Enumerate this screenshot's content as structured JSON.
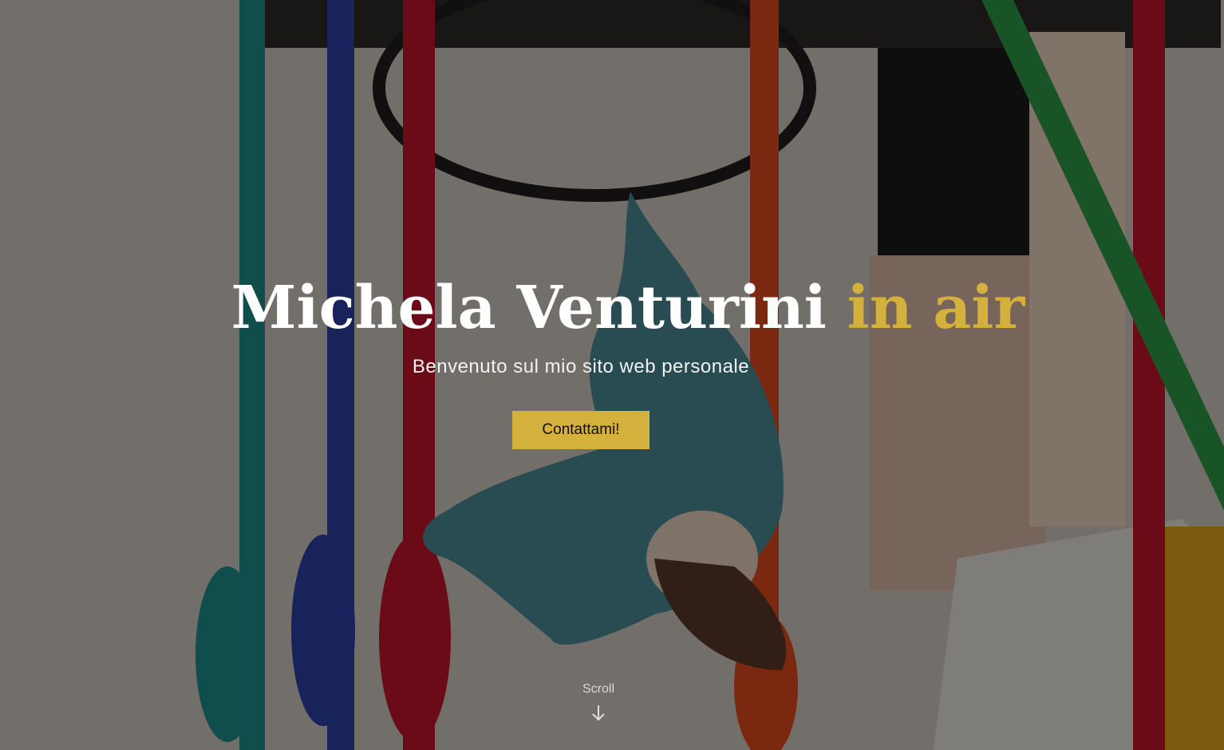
{
  "hero": {
    "title_main": "Michela Venturini",
    "title_accent": "in air",
    "subtitle": "Benvenuto sul mio sito web personale",
    "cta_label": "Contattami!",
    "scroll_label": "Scroll",
    "scroll_icon": "arrow-down-icon"
  },
  "colors": {
    "accent": "#d4b13c",
    "title": "#ffffff",
    "overlay": "rgba(0,0,0,0.45)"
  }
}
